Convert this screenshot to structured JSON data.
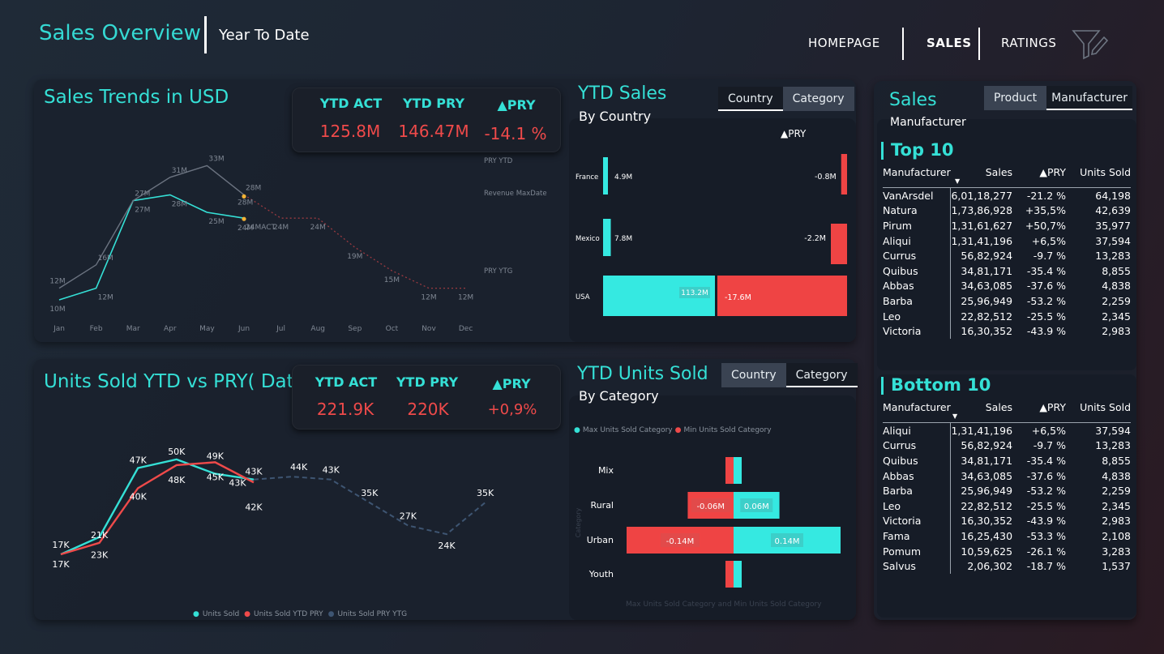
{
  "header": {
    "title": "Sales Overview",
    "subtitle": "Year To Date",
    "nav": [
      "HOMEPAGE",
      "SALES",
      "RATINGS"
    ],
    "filter_icon": "funnel-edit-icon"
  },
  "sales_trends": {
    "title": "Sales Trends in USD",
    "kpi": [
      {
        "label": "YTD ACT",
        "value": "125.8M"
      },
      {
        "label": "YTD PRY",
        "value": "146.47M"
      },
      {
        "label": "▲PRY",
        "value": "-14.1 %"
      }
    ],
    "months": [
      "Jan",
      "Feb",
      "Mar",
      "Apr",
      "May",
      "Jun",
      "Jul",
      "Aug",
      "Sep",
      "Oct",
      "Nov",
      "Dec"
    ],
    "side_labels": [
      "PRY YTD",
      "Revenue MaxDate",
      "PRY YTG"
    ],
    "chart_data": {
      "type": "line",
      "categories": [
        "Jan",
        "Feb",
        "Mar",
        "Apr",
        "May",
        "Jun",
        "Jul",
        "Aug",
        "Sep",
        "Oct",
        "Nov",
        "Dec"
      ],
      "series": [
        {
          "name": "ACT",
          "values": [
            10,
            12,
            27,
            28,
            25,
            24,
            null,
            null,
            null,
            null,
            null,
            null
          ]
        },
        {
          "name": "PRY YTD",
          "values": [
            12,
            16,
            27,
            31,
            33,
            28,
            null,
            null,
            null,
            null,
            null,
            null
          ]
        },
        {
          "name": "PRY YTG",
          "values": [
            null,
            null,
            null,
            null,
            null,
            28,
            24,
            24,
            19,
            15,
            12,
            12
          ]
        }
      ],
      "point_labels": {
        "ACT": [
          "10M",
          "12M",
          "27M",
          "28M",
          "25M",
          "24MACT"
        ],
        "PRY YTD": [
          "12M",
          "16M",
          "27M",
          "31M",
          "33M",
          "28M"
        ],
        "PRY YTG": [
          "28M",
          "24M",
          "24M",
          "19M",
          "15M",
          "12M",
          "12M"
        ],
        "ACT_jun_extra": "24M"
      },
      "colors": {
        "ACT": "#35e0d6",
        "PRY YTD": "#6b7380",
        "PRY YTG": "#9a3a40",
        "marker": "#f2b134"
      }
    }
  },
  "ytd_sales": {
    "title": "YTD Sales",
    "subtitle": "By Country",
    "toggle": [
      "Country",
      "Category"
    ],
    "pry_header": "▲PRY",
    "chart_data": {
      "type": "bar",
      "categories": [
        "France",
        "Mexico",
        "USA"
      ],
      "series": [
        {
          "name": "YTD Sales",
          "values": [
            4.9,
            7.8,
            113.2
          ],
          "labels": [
            "4.9M",
            "7.8M",
            "113.2M"
          ]
        },
        {
          "name": "▲PRY",
          "values": [
            -0.8,
            -2.2,
            -17.6
          ],
          "labels": [
            "-0.8M",
            "-2.2M",
            "-17.6M"
          ]
        }
      ]
    }
  },
  "units_sold": {
    "title": "Units Sold YTD vs PRY( Date)",
    "kpi": [
      {
        "label": "YTD ACT",
        "value": "221.9K"
      },
      {
        "label": "YTD PRY",
        "value": "220K"
      },
      {
        "label": "▲PRY",
        "value": "+0,9%"
      }
    ],
    "legend": [
      "Units Sold",
      "Units Sold YTD PRY",
      "Units Sold PRY YTG"
    ],
    "chart_data": {
      "type": "line",
      "categories": [
        "Jan",
        "Feb",
        "Mar",
        "Apr",
        "May",
        "Jun",
        "Jul",
        "Aug",
        "Sep",
        "Oct",
        "Nov",
        "Dec"
      ],
      "series": [
        {
          "name": "Units Sold",
          "values": [
            17,
            23,
            47,
            50,
            45,
            43,
            null,
            null,
            null,
            null,
            null,
            null
          ]
        },
        {
          "name": "Units Sold YTD PRY",
          "values": [
            17,
            21,
            40,
            48,
            49,
            42,
            null,
            null,
            null,
            null,
            null,
            null
          ]
        },
        {
          "name": "Units Sold PRY YTG",
          "values": [
            null,
            null,
            null,
            null,
            null,
            43,
            44,
            43,
            35,
            27,
            24,
            35
          ]
        }
      ],
      "point_labels": {
        "Units Sold": [
          "17K",
          "23K",
          "47K",
          "50K",
          "45K",
          "43K"
        ],
        "Units Sold YTD PRY": [
          "17K",
          "21K",
          "40K",
          "48K",
          "49K",
          "42K"
        ],
        "Units Sold PRY YTG": [
          "43K",
          "44K",
          "43K",
          "35K",
          "27K",
          "24K",
          "35K"
        ]
      },
      "colors": {
        "Units Sold": "#35e0d6",
        "Units Sold YTD PRY": "#ef4a4a",
        "Units Sold PRY YTG": "#3e5572"
      }
    }
  },
  "ytd_units": {
    "title": "YTD Units Sold",
    "subtitle": "By Category",
    "toggle": [
      "Country",
      "Category"
    ],
    "legend": [
      "Max Units Sold Category",
      "Min Units Sold Category"
    ],
    "footer": "Max Units Sold Category and Min Units Sold Category",
    "axis_title": "Category",
    "chart_data": {
      "type": "bar",
      "categories": [
        "Mix",
        "Rural",
        "Urban",
        "Youth"
      ],
      "series": [
        {
          "name": "Max Units Sold Category",
          "values": [
            0.01,
            0.06,
            0.14,
            0.01
          ],
          "labels": [
            "",
            "0.06M",
            "0.14M",
            ""
          ]
        },
        {
          "name": "Min Units Sold Category",
          "values": [
            -0.01,
            -0.06,
            -0.14,
            -0.01
          ],
          "labels": [
            "",
            "-0.06M",
            "-0.14M",
            ""
          ]
        }
      ]
    }
  },
  "manufacturer_panel": {
    "title": "Sales",
    "subtitle": "Manufacturer",
    "toggle": [
      "Product",
      "Manufacturer"
    ],
    "columns": [
      "Manufacturer",
      "Sales",
      "▲PRY",
      "Units Sold"
    ],
    "top10": {
      "title": "Top 10",
      "rows": [
        [
          "VanArsdel",
          "6,01,18,277",
          "-21.2 %",
          "64,198"
        ],
        [
          "Natura",
          "1,73,86,928",
          "+35,5%",
          "42,639"
        ],
        [
          "Pirum",
          "1,31,61,627",
          "+50,7%",
          "35,977"
        ],
        [
          "Aliqui",
          "1,31,41,196",
          "+6,5%",
          "37,594"
        ],
        [
          "Currus",
          "56,82,924",
          "-9.7 %",
          "13,283"
        ],
        [
          "Quibus",
          "34,81,171",
          "-35.4 %",
          "8,855"
        ],
        [
          "Abbas",
          "34,63,085",
          "-37.6 %",
          "4,838"
        ],
        [
          "Barba",
          "25,96,949",
          "-53.2 %",
          "2,259"
        ],
        [
          "Leo",
          "22,82,512",
          "-25.5 %",
          "2,345"
        ],
        [
          "Victoria",
          "16,30,352",
          "-43.9 %",
          "2,983"
        ]
      ]
    },
    "bottom10": {
      "title": "Bottom 10",
      "rows": [
        [
          "Aliqui",
          "1,31,41,196",
          "+6,5%",
          "37,594"
        ],
        [
          "Currus",
          "56,82,924",
          "-9.7 %",
          "13,283"
        ],
        [
          "Quibus",
          "34,81,171",
          "-35.4 %",
          "8,855"
        ],
        [
          "Abbas",
          "34,63,085",
          "-37.6 %",
          "4,838"
        ],
        [
          "Barba",
          "25,96,949",
          "-53.2 %",
          "2,259"
        ],
        [
          "Leo",
          "22,82,512",
          "-25.5 %",
          "2,345"
        ],
        [
          "Victoria",
          "16,30,352",
          "-43.9 %",
          "2,983"
        ],
        [
          "Fama",
          "16,25,430",
          "-53.3 %",
          "2,108"
        ],
        [
          "Pomum",
          "10,59,625",
          "-26.1 %",
          "3,283"
        ],
        [
          "Salvus",
          "2,06,302",
          "-18.7 %",
          "1,537"
        ]
      ]
    }
  }
}
